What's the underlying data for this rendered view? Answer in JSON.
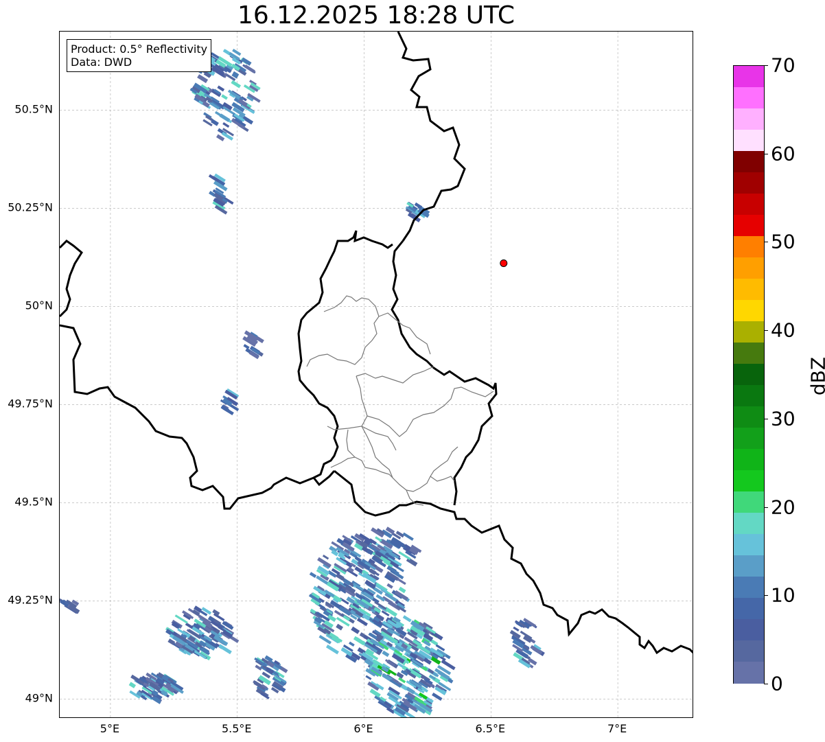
{
  "title": "16.12.2025 18:28 UTC",
  "infobox": {
    "product": "Product: 0.5° Reflectivity",
    "data": "Data: DWD"
  },
  "map": {
    "lon_range": [
      4.8,
      7.3
    ],
    "lat_range": [
      48.95,
      50.7
    ],
    "lat_ticks": [
      {
        "value": 50.5,
        "label": "50.5°N"
      },
      {
        "value": 50.25,
        "label": "50.25°N"
      },
      {
        "value": 50.0,
        "label": "50°N"
      },
      {
        "value": 49.75,
        "label": "49.75°N"
      },
      {
        "value": 49.5,
        "label": "49.5°N"
      },
      {
        "value": 49.25,
        "label": "49.25°N"
      },
      {
        "value": 49.0,
        "label": "49°N"
      }
    ],
    "lon_ticks": [
      {
        "value": 5.0,
        "label": "5°E"
      },
      {
        "value": 5.5,
        "label": "5.5°E"
      },
      {
        "value": 6.0,
        "label": "6°E"
      },
      {
        "value": 6.5,
        "label": "6.5°E"
      },
      {
        "value": 7.0,
        "label": "7°E"
      }
    ],
    "radar_site": {
      "lon": 6.55,
      "lat": 50.11,
      "color": "#ff0000"
    }
  },
  "colorbar": {
    "unit": "dBZ",
    "min": 0,
    "max": 70,
    "ticks": [
      {
        "value": 0,
        "label": "0"
      },
      {
        "value": 10,
        "label": "10"
      },
      {
        "value": 20,
        "label": "20"
      },
      {
        "value": 30,
        "label": "30"
      },
      {
        "value": 40,
        "label": "40"
      },
      {
        "value": 50,
        "label": "50"
      },
      {
        "value": 60,
        "label": "60"
      },
      {
        "value": 70,
        "label": "70"
      }
    ],
    "colors": [
      "#6672a8",
      "#56689f",
      "#4a5ea0",
      "#4567a8",
      "#4a7bb5",
      "#5a9ec8",
      "#66c2da",
      "#63d8c4",
      "#40d87a",
      "#14c81e",
      "#10b418",
      "#12a01a",
      "#0f8c14",
      "#0a7810",
      "#08640c",
      "#467a0e",
      "#aab000",
      "#ffd700",
      "#ffbb00",
      "#ff9f00",
      "#ff7f00",
      "#e60000",
      "#c80000",
      "#a00000",
      "#800000",
      "#ffe0ff",
      "#ffb0ff",
      "#ff70ff",
      "#e834e8"
    ]
  }
}
